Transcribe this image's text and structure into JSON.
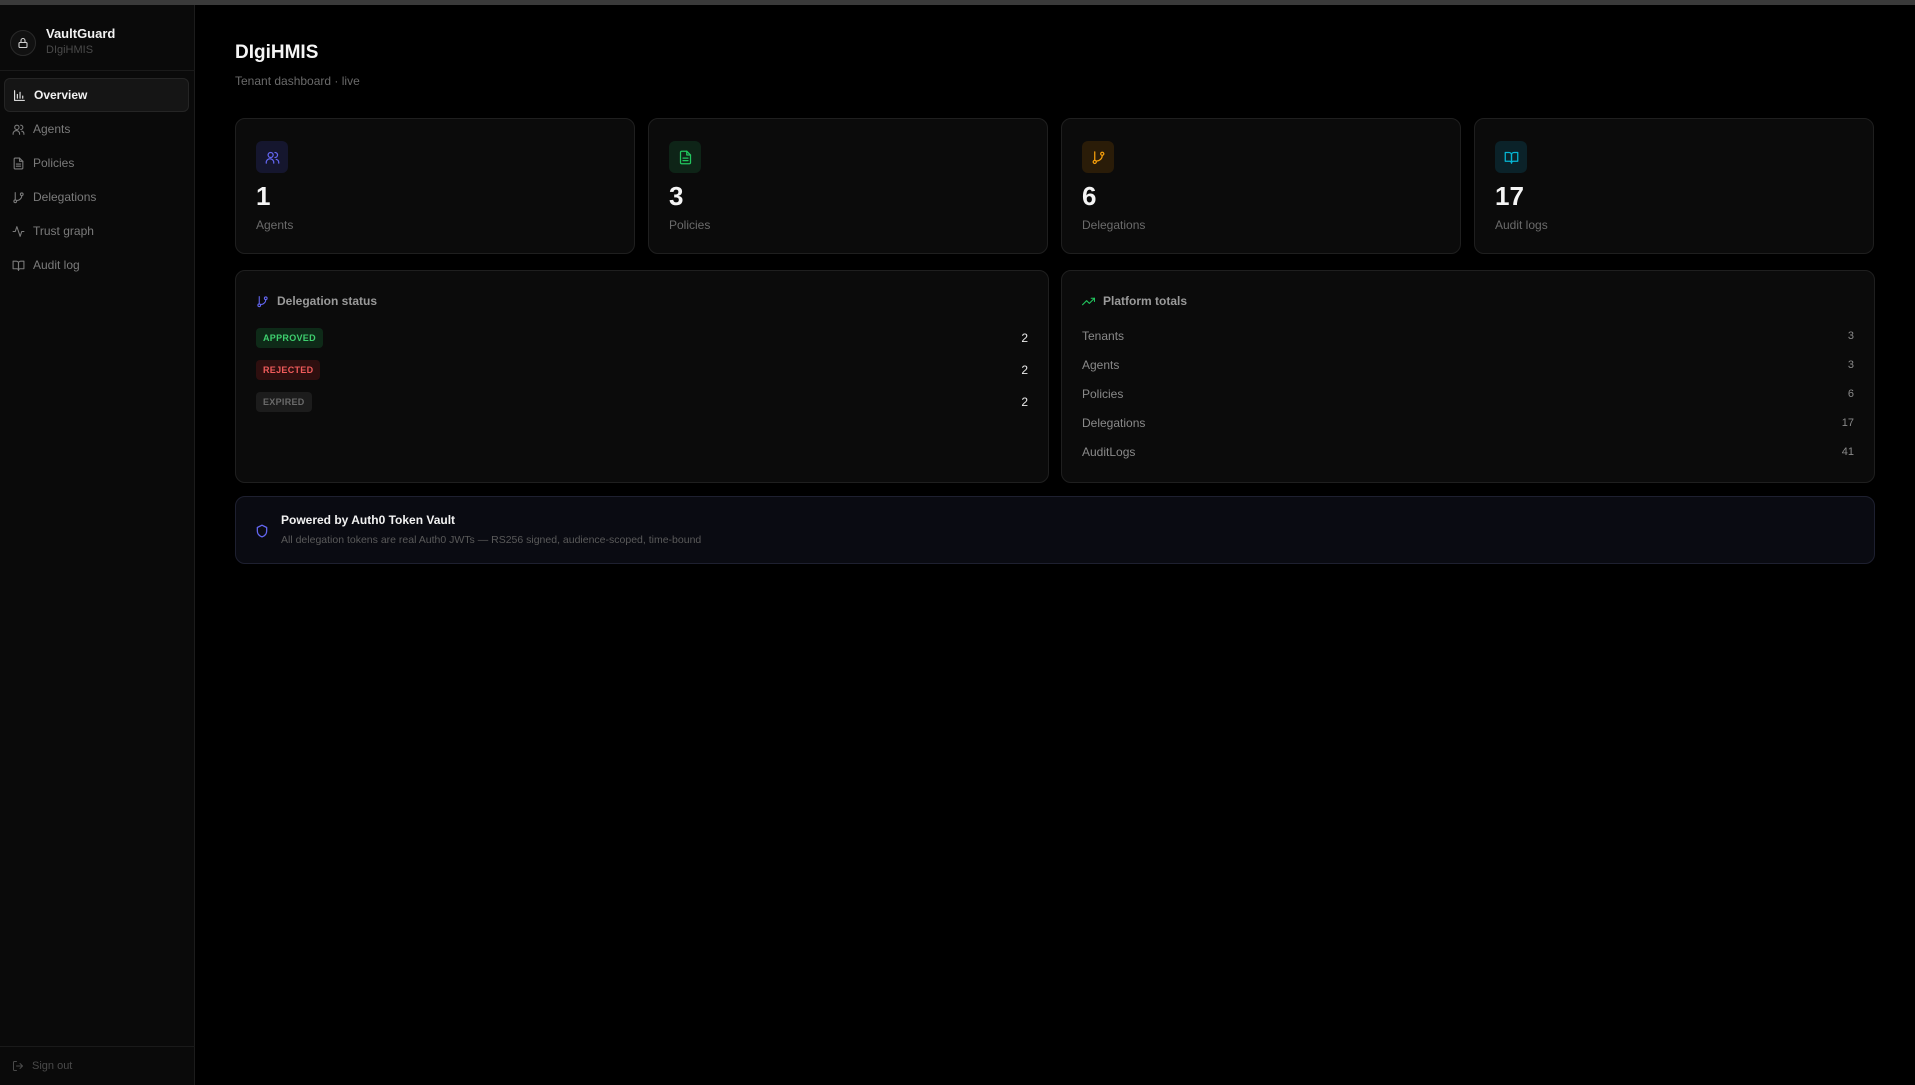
{
  "brand": {
    "name": "VaultGuard",
    "tenant": "DIgiHMIS",
    "icon": "lock-icon"
  },
  "nav": {
    "items": [
      {
        "label": "Overview",
        "icon": "bar-chart-icon",
        "active": true
      },
      {
        "label": "Agents",
        "icon": "users-icon",
        "active": false
      },
      {
        "label": "Policies",
        "icon": "file-text-icon",
        "active": false
      },
      {
        "label": "Delegations",
        "icon": "git-branch-icon",
        "active": false
      },
      {
        "label": "Trust graph",
        "icon": "activity-icon",
        "active": false
      },
      {
        "label": "Audit log",
        "icon": "book-open-icon",
        "active": false
      }
    ],
    "signout_label": "Sign out"
  },
  "header": {
    "title": "DIgiHMIS",
    "subtitle": "Tenant dashboard · live"
  },
  "stats": [
    {
      "value": "1",
      "label": "Agents",
      "icon": "users-icon",
      "color": "#6366f1"
    },
    {
      "value": "3",
      "label": "Policies",
      "icon": "file-text-icon",
      "color": "#22c55e"
    },
    {
      "value": "6",
      "label": "Delegations",
      "icon": "git-branch-icon",
      "color": "#f59e0b"
    },
    {
      "value": "17",
      "label": "Audit logs",
      "icon": "book-open-icon",
      "color": "#06b6d4"
    }
  ],
  "delegation_status": {
    "title": "Delegation status",
    "rows": [
      {
        "status": "APPROVED",
        "count": "2",
        "color": "#3ecf6e"
      },
      {
        "status": "REJECTED",
        "count": "2",
        "color": "#ef5b5b"
      },
      {
        "status": "EXPIRED",
        "count": "2",
        "color": "#6a6a6a"
      }
    ]
  },
  "platform_totals": {
    "title": "Platform totals",
    "rows": [
      {
        "label": "Tenants",
        "value": "3"
      },
      {
        "label": "Agents",
        "value": "3"
      },
      {
        "label": "Policies",
        "value": "6"
      },
      {
        "label": "Delegations",
        "value": "17"
      },
      {
        "label": "AuditLogs",
        "value": "41"
      }
    ]
  },
  "banner": {
    "title": "Powered by Auth0 Token Vault",
    "text": "All delegation tokens are real Auth0 JWTs — RS256 signed, audience-scoped, time-bound"
  }
}
